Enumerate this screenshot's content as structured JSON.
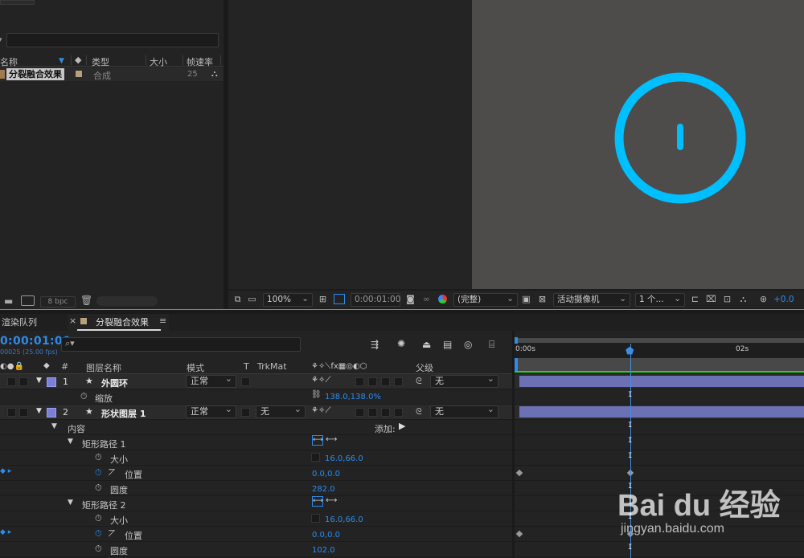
{
  "project_panel": {
    "columns": [
      "名称",
      "类型",
      "大小",
      "帧速率"
    ],
    "item": {
      "name": "分裂融合效果",
      "type": "合成",
      "fps": "25"
    },
    "bpc_label": "8 bpc"
  },
  "viewer": {
    "zoom": "100%",
    "timecode": "0:00:01:00",
    "resolution": "(完整)",
    "camera": "活动摄像机",
    "views": "1 个...",
    "exposure": "+0.0",
    "colors": {
      "ring": "#00bfff",
      "canvas": "#4e4b4b"
    }
  },
  "timeline": {
    "tabs": [
      {
        "label": "渲染队列"
      },
      {
        "label": "分裂融合效果"
      }
    ],
    "current_time": "0:00:01:00",
    "fps_label": "00025 (25.00 fps)",
    "columns": {
      "number": "#",
      "layer_name": "图层名称",
      "mode": "模式",
      "t": "T",
      "trkmat": "TrkMat",
      "parent": "父级"
    },
    "ruler": {
      "start": "0:00s",
      "mark_2": "02s"
    },
    "layers": [
      {
        "num": "1",
        "name": "外圆环",
        "mode": "正常",
        "parent": "无"
      },
      {
        "num": "2",
        "name": "形状图层 1",
        "mode": "正常",
        "trkmat": "无",
        "parent": "无"
      }
    ],
    "scale": {
      "label": "缩放",
      "value": "138.0,138.0%"
    },
    "contents_label": "内容",
    "add_label": "添加:",
    "rect_paths": [
      {
        "label": "矩形路径 1",
        "size_label": "大小",
        "size": "16.0,66.0",
        "pos_label": "位置",
        "pos": "0.0,0.0",
        "round_label": "圆度",
        "round": "282.0"
      },
      {
        "label": "矩形路径 2",
        "size_label": "大小",
        "size": "16.0,66.0",
        "pos_label": "位置",
        "pos": "0.0,0.0",
        "round_label": "圆度",
        "round": "102.0"
      }
    ]
  },
  "watermark": {
    "brand": "Bai du 经验",
    "url": "jingyan.baidu.com"
  }
}
